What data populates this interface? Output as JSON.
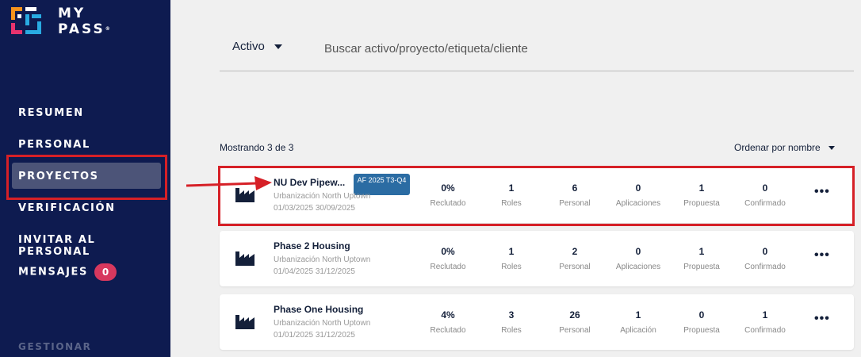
{
  "brand": {
    "line1": "MY",
    "line2": "PASS",
    "mark": "®"
  },
  "colors": {
    "sidebar": "#0e1b50",
    "accent_red": "#d62027",
    "tag_blue": "#2b6ca3",
    "badge_pink": "#d7385e"
  },
  "nav": {
    "items": [
      {
        "label": "RESUMEN"
      },
      {
        "label": "PERSONAL"
      },
      {
        "label": "PROYECTOS",
        "active": true
      },
      {
        "label": "VERIFICACIÓN"
      },
      {
        "label": "INVITAR AL PERSONAL"
      },
      {
        "label": "MENSAJES",
        "badge": "0"
      }
    ],
    "section": "GESTIONAR"
  },
  "search": {
    "asset_label": "Activo",
    "placeholder": "Buscar activo/proyecto/etiqueta/cliente"
  },
  "list": {
    "showing": "Mostrando 3 de 3",
    "sort_label": "Ordenar por nombre"
  },
  "stat_labels": [
    "Reclutado",
    "Roles",
    "Personal"
  ],
  "projects": [
    {
      "name": "NU Dev Pipew...",
      "tag": "AF 2025 T3-Q4",
      "location": "Urbanización North Uptown",
      "dates": "01/03/2025 30/09/2025",
      "recruited": "0%",
      "roles": "1",
      "personnel": "6",
      "applications": "0",
      "applications_label": "Aplicaciones",
      "proposed": "1",
      "proposed_label": "Propuesta",
      "confirmed": "0",
      "confirmed_label": "Confirmado"
    },
    {
      "name": "Phase 2 Housing",
      "location": "Urbanización North Uptown",
      "dates": "01/04/2025 31/12/2025",
      "recruited": "0%",
      "roles": "1",
      "personnel": "2",
      "applications": "0",
      "applications_label": "Aplicaciones",
      "proposed": "1",
      "proposed_label": "Propuesta",
      "confirmed": "0",
      "confirmed_label": "Confirmado"
    },
    {
      "name": "Phase One Housing",
      "location": "Urbanización North Uptown",
      "dates": "01/01/2025 31/12/2025",
      "recruited": "4%",
      "roles": "3",
      "personnel": "26",
      "applications": "1",
      "applications_label": "Aplicación",
      "proposed": "0",
      "proposed_label": "Propuesta",
      "confirmed": "1",
      "confirmed_label": "Confirmado"
    }
  ],
  "more_glyph": "•••"
}
